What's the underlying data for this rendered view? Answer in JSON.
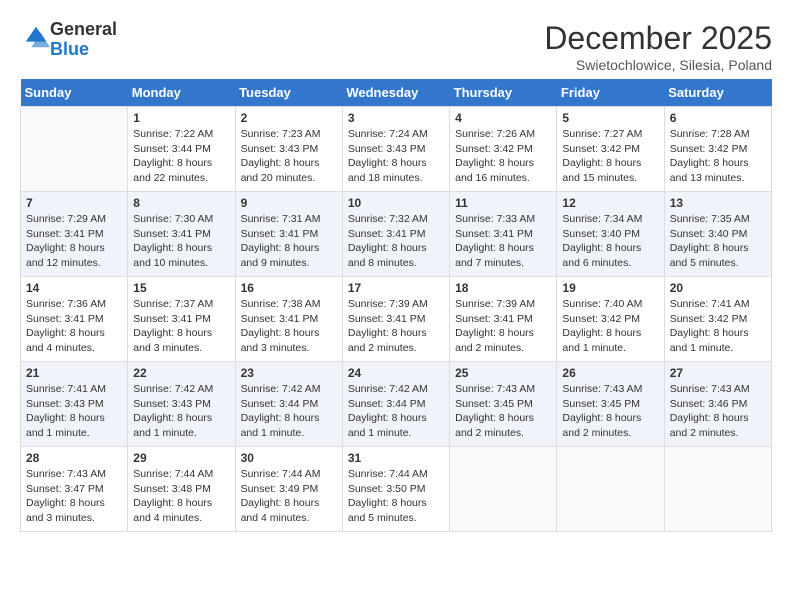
{
  "logo": {
    "general": "General",
    "blue": "Blue"
  },
  "title": "December 2025",
  "subtitle": "Swietochlowice, Silesia, Poland",
  "days_of_week": [
    "Sunday",
    "Monday",
    "Tuesday",
    "Wednesday",
    "Thursday",
    "Friday",
    "Saturday"
  ],
  "weeks": [
    [
      {
        "day": "",
        "empty": true
      },
      {
        "day": "1",
        "sunrise": "7:22 AM",
        "sunset": "3:44 PM",
        "daylight": "8 hours and 22 minutes."
      },
      {
        "day": "2",
        "sunrise": "7:23 AM",
        "sunset": "3:43 PM",
        "daylight": "8 hours and 20 minutes."
      },
      {
        "day": "3",
        "sunrise": "7:24 AM",
        "sunset": "3:43 PM",
        "daylight": "8 hours and 18 minutes."
      },
      {
        "day": "4",
        "sunrise": "7:26 AM",
        "sunset": "3:42 PM",
        "daylight": "8 hours and 16 minutes."
      },
      {
        "day": "5",
        "sunrise": "7:27 AM",
        "sunset": "3:42 PM",
        "daylight": "8 hours and 15 minutes."
      },
      {
        "day": "6",
        "sunrise": "7:28 AM",
        "sunset": "3:42 PM",
        "daylight": "8 hours and 13 minutes."
      }
    ],
    [
      {
        "day": "7",
        "sunrise": "7:29 AM",
        "sunset": "3:41 PM",
        "daylight": "8 hours and 12 minutes."
      },
      {
        "day": "8",
        "sunrise": "7:30 AM",
        "sunset": "3:41 PM",
        "daylight": "8 hours and 10 minutes."
      },
      {
        "day": "9",
        "sunrise": "7:31 AM",
        "sunset": "3:41 PM",
        "daylight": "8 hours and 9 minutes."
      },
      {
        "day": "10",
        "sunrise": "7:32 AM",
        "sunset": "3:41 PM",
        "daylight": "8 hours and 8 minutes."
      },
      {
        "day": "11",
        "sunrise": "7:33 AM",
        "sunset": "3:41 PM",
        "daylight": "8 hours and 7 minutes."
      },
      {
        "day": "12",
        "sunrise": "7:34 AM",
        "sunset": "3:40 PM",
        "daylight": "8 hours and 6 minutes."
      },
      {
        "day": "13",
        "sunrise": "7:35 AM",
        "sunset": "3:40 PM",
        "daylight": "8 hours and 5 minutes."
      }
    ],
    [
      {
        "day": "14",
        "sunrise": "7:36 AM",
        "sunset": "3:41 PM",
        "daylight": "8 hours and 4 minutes."
      },
      {
        "day": "15",
        "sunrise": "7:37 AM",
        "sunset": "3:41 PM",
        "daylight": "8 hours and 3 minutes."
      },
      {
        "day": "16",
        "sunrise": "7:38 AM",
        "sunset": "3:41 PM",
        "daylight": "8 hours and 3 minutes."
      },
      {
        "day": "17",
        "sunrise": "7:39 AM",
        "sunset": "3:41 PM",
        "daylight": "8 hours and 2 minutes."
      },
      {
        "day": "18",
        "sunrise": "7:39 AM",
        "sunset": "3:41 PM",
        "daylight": "8 hours and 2 minutes."
      },
      {
        "day": "19",
        "sunrise": "7:40 AM",
        "sunset": "3:42 PM",
        "daylight": "8 hours and 1 minute."
      },
      {
        "day": "20",
        "sunrise": "7:41 AM",
        "sunset": "3:42 PM",
        "daylight": "8 hours and 1 minute."
      }
    ],
    [
      {
        "day": "21",
        "sunrise": "7:41 AM",
        "sunset": "3:43 PM",
        "daylight": "8 hours and 1 minute."
      },
      {
        "day": "22",
        "sunrise": "7:42 AM",
        "sunset": "3:43 PM",
        "daylight": "8 hours and 1 minute."
      },
      {
        "day": "23",
        "sunrise": "7:42 AM",
        "sunset": "3:44 PM",
        "daylight": "8 hours and 1 minute."
      },
      {
        "day": "24",
        "sunrise": "7:42 AM",
        "sunset": "3:44 PM",
        "daylight": "8 hours and 1 minute."
      },
      {
        "day": "25",
        "sunrise": "7:43 AM",
        "sunset": "3:45 PM",
        "daylight": "8 hours and 2 minutes."
      },
      {
        "day": "26",
        "sunrise": "7:43 AM",
        "sunset": "3:45 PM",
        "daylight": "8 hours and 2 minutes."
      },
      {
        "day": "27",
        "sunrise": "7:43 AM",
        "sunset": "3:46 PM",
        "daylight": "8 hours and 2 minutes."
      }
    ],
    [
      {
        "day": "28",
        "sunrise": "7:43 AM",
        "sunset": "3:47 PM",
        "daylight": "8 hours and 3 minutes."
      },
      {
        "day": "29",
        "sunrise": "7:44 AM",
        "sunset": "3:48 PM",
        "daylight": "8 hours and 4 minutes."
      },
      {
        "day": "30",
        "sunrise": "7:44 AM",
        "sunset": "3:49 PM",
        "daylight": "8 hours and 4 minutes."
      },
      {
        "day": "31",
        "sunrise": "7:44 AM",
        "sunset": "3:50 PM",
        "daylight": "8 hours and 5 minutes."
      },
      {
        "day": "",
        "empty": true
      },
      {
        "day": "",
        "empty": true
      },
      {
        "day": "",
        "empty": true
      }
    ]
  ]
}
